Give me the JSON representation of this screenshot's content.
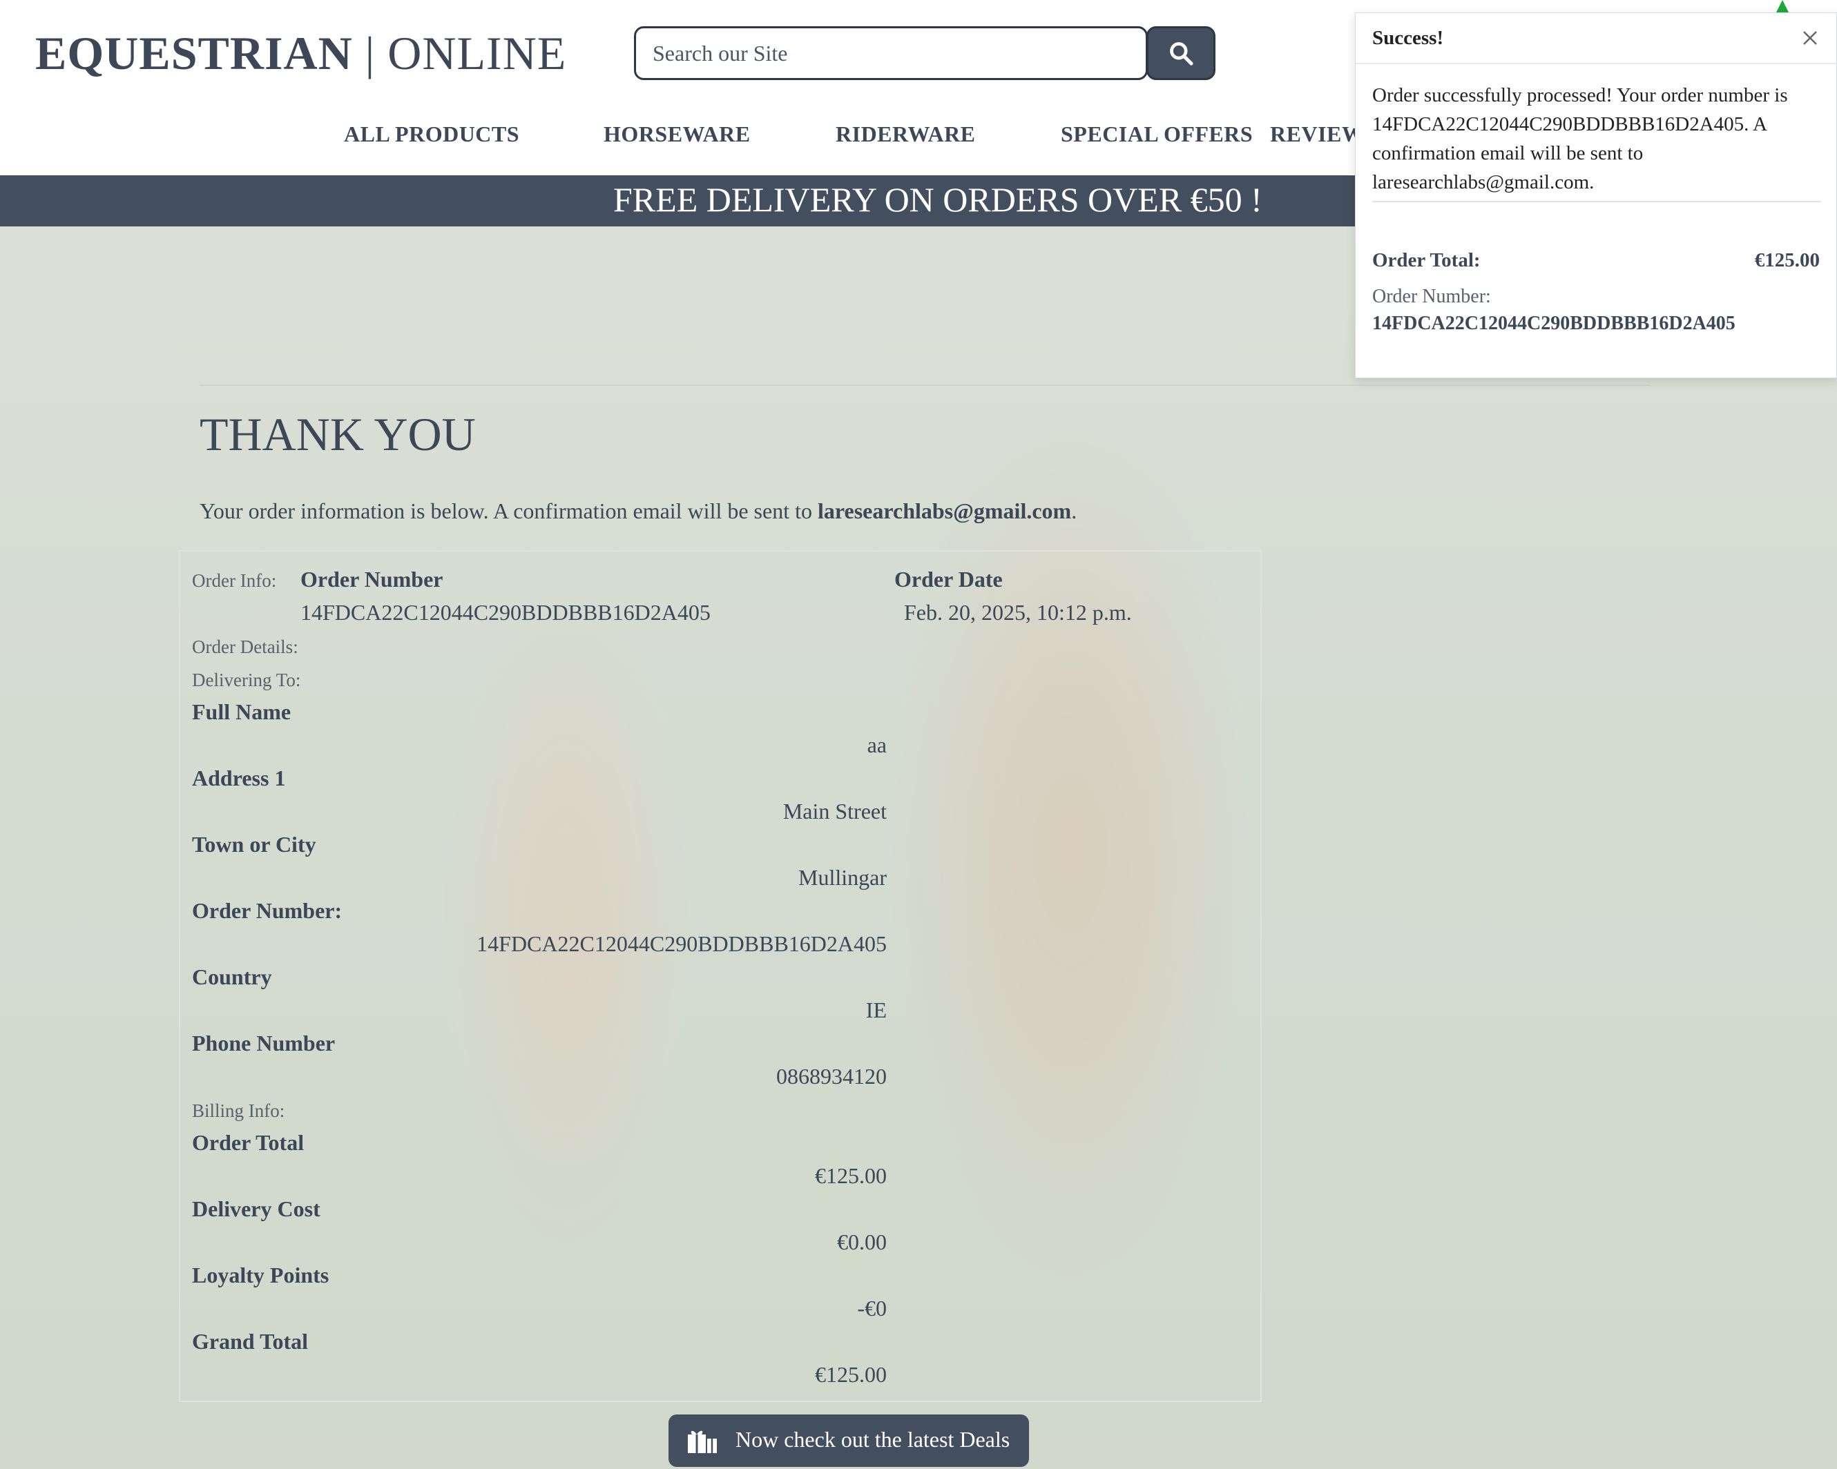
{
  "header": {
    "logo_bold": "EQUESTRIAN",
    "logo_sep": " | ",
    "logo_light": "ONLINE",
    "search_placeholder": "Search our Site"
  },
  "nav": {
    "items": [
      "ALL PRODUCTS",
      "HORSEWARE",
      "RIDERWARE",
      "SPECIAL OFFERS",
      "REVIEW"
    ]
  },
  "banner": {
    "text": "FREE DELIVERY ON ORDERS OVER €50 !"
  },
  "main": {
    "title": "THANK YOU",
    "intro_text": "Your order information is below. A confirmation email will be sent to ",
    "intro_email": "laresearchlabs@gmail.com",
    "intro_end": "."
  },
  "order": {
    "order_info_label": "Order Info:",
    "order_number_heading": "Order Number",
    "order_number": "14FDCA22C12044C290BDDBBB16D2A405",
    "order_date_heading": "Order Date",
    "order_date": "Feb. 20, 2025, 10:12 p.m.",
    "order_details_label": "Order Details:",
    "delivering_to_label": "Delivering To:",
    "full_name_heading": "Full Name",
    "full_name": "aa",
    "address1_heading": "Address 1",
    "address1": "Main Street",
    "town_heading": "Town or City",
    "town": "Mullingar",
    "order_number2_heading": "Order Number:",
    "order_number2": "14FDCA22C12044C290BDDBBB16D2A405",
    "country_heading": "Country",
    "country": "IE",
    "phone_heading": "Phone Number",
    "phone": "0868934120",
    "billing_info_label": "Billing Info:",
    "order_total_heading": "Order Total",
    "order_total": "€125.00",
    "delivery_cost_heading": "Delivery Cost",
    "delivery_cost": "€0.00",
    "loyalty_heading": "Loyalty Points",
    "loyalty": "-€0",
    "grand_total_heading": "Grand Total",
    "grand_total": "€125.00"
  },
  "deals_button": {
    "label": "Now check out the latest Deals",
    "icon": "gift-icon"
  },
  "toast": {
    "title": "Success!",
    "message": "Order successfully processed! Your order number is 14FDCA22C12044C290BDDBBB16D2A405. A confirmation email will be sent to laresearchlabs@gmail.com.",
    "total_label": "Order Total:",
    "total_value": "€125.00",
    "number_label": "Order Number:",
    "number_value": "14FDCA22C12044C290BDDBBB16D2A405"
  },
  "colors": {
    "brand_dark": "#434f5e",
    "text": "#3c4757",
    "toast_accent": "#1fa83a"
  }
}
